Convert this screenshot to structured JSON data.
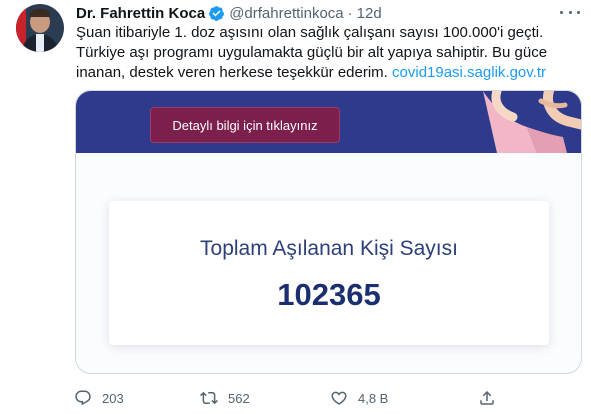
{
  "tweet": {
    "author_name": "Dr. Fahrettin Koca",
    "handle": "@drfahrettinkoca",
    "separator": "·",
    "time": "12d",
    "text": "Şuan itibariyle 1. doz aşısını olan sağlık çalışanı sayısı 100.000'i geçti. Türkiye aşı programı uygulamakta güçlü bir alt yapıya sahiptir. Bu güce inanan, destek veren herkese teşekkür ederim.",
    "link_text": "covid19asi.saglik.gov.tr"
  },
  "card": {
    "banner_button": "Detaylı bilgi için tıklayınız",
    "stat_label": "Toplam Aşılanan Kişi Sayısı",
    "stat_value": "102365"
  },
  "actions": {
    "replies": "203",
    "retweets": "562",
    "likes": "4,8 B"
  },
  "colors": {
    "link": "#1d9bf0",
    "banner": "#2e3a8c",
    "button": "#7d1f4c",
    "stat_text": "#1b2f70"
  },
  "icons": [
    "verified-badge-icon",
    "more-options-icon",
    "reply-icon",
    "retweet-icon",
    "like-icon",
    "share-icon"
  ]
}
